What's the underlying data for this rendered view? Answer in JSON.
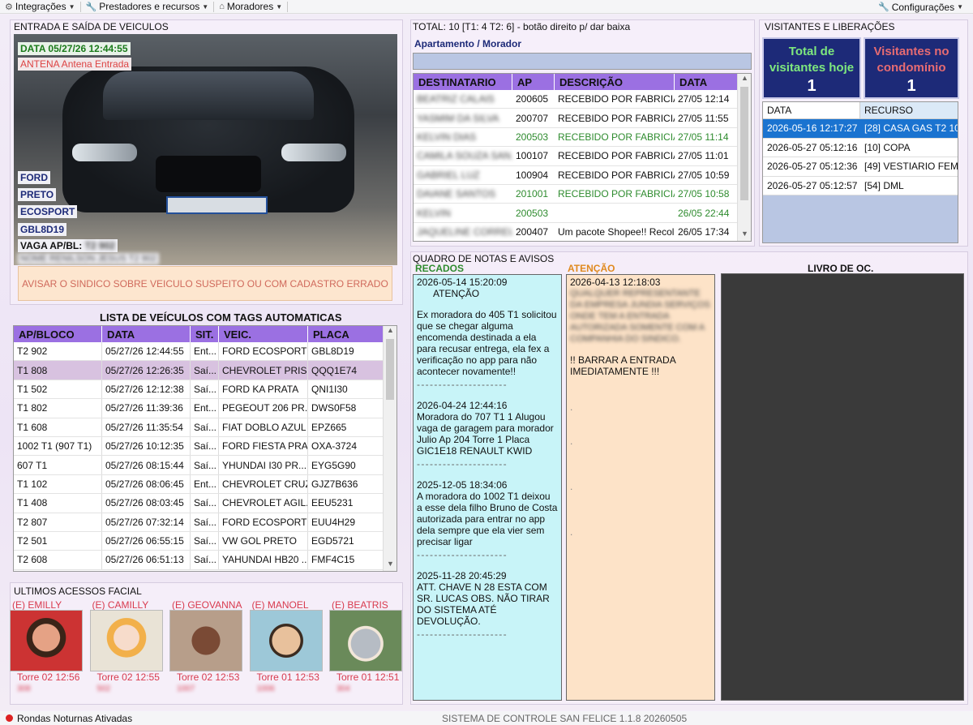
{
  "menu": {
    "integracoes": "Integrações",
    "prestadores": "Prestadores e recursos",
    "moradores": "Moradores",
    "configuracoes": "Configurações"
  },
  "vehicle_panel": {
    "title": "ENTRADA E SAÍDA DE VEICULOS",
    "date": "DATA 05/27/26 12:44:55",
    "antenna": "ANTENA Antena Entrada",
    "brand": "FORD",
    "color": "PRETO",
    "model": "ECOSPORT",
    "plate": "GBL8D19",
    "vaga_label": "VAGA AP/BL:",
    "vaga_value": "T2 902",
    "owner": "NOME RENILSON JESUS T2 902",
    "warning": "AVISAR O SINDICO SOBRE VEICULO SUSPEITO OU COM CADASTRO ERRADO"
  },
  "vehicle_list": {
    "title": "LISTA DE VEÍCULOS COM TAGS AUTOMATICAS",
    "columns": [
      "AP/BLOCO",
      "DATA",
      "SIT.",
      "VEIC.",
      "PLACA"
    ],
    "rows": [
      [
        "T2 902",
        "05/27/26 12:44:55",
        "Ent...",
        "FORD ECOSPORT ...",
        "GBL8D19"
      ],
      [
        "T1 808",
        "05/27/26 12:26:35",
        "Saí...",
        "CHEVROLET PRIS...",
        "QQQ1E74"
      ],
      [
        "T1 502",
        "05/27/26 12:12:38",
        "Saí...",
        "FORD KA PRATA",
        "QNI1I30"
      ],
      [
        "T1 802",
        "05/27/26 11:39:36",
        "Ent...",
        "PEGEOUT 206 PR...",
        "DWS0F58"
      ],
      [
        "T1 608",
        "05/27/26 11:35:54",
        "Saí...",
        "FIAT DOBLO AZUL",
        "EPZ665"
      ],
      [
        "1002 T1 (907 T1)",
        "05/27/26 10:12:35",
        "Saí...",
        "FORD FIESTA PRA...",
        "OXA-3724"
      ],
      [
        "607 T1",
        "05/27/26 08:15:44",
        "Saí...",
        "YHUNDAI I30 PR...",
        "EYG5G90"
      ],
      [
        "T1 102",
        "05/27/26 08:06:45",
        "Ent...",
        "CHEVROLET CRUZ...",
        "GJZ7B636"
      ],
      [
        "T1 408",
        "05/27/26 08:03:45",
        "Saí...",
        "CHEVROLET AGIL...",
        "EEU5231"
      ],
      [
        "T2 807",
        "05/27/26 07:32:14",
        "Saí...",
        "FORD ECOSPORT ...",
        "EUU4H29"
      ],
      [
        "T2 501",
        "05/27/26 06:55:15",
        "Saí...",
        "VW GOL PRETO",
        "EGD5721"
      ],
      [
        "T2 608",
        "05/27/26 06:51:13",
        "Saí...",
        "YAHUNDAI HB20 ...",
        "FMF4C15"
      ]
    ]
  },
  "facial": {
    "title": "ULTIMOS ACESSOS FACIAL",
    "items": [
      {
        "name": "(E) EMILLY",
        "time": "Torre 02 12:56",
        "id": "308"
      },
      {
        "name": "(E) CAMILLY",
        "time": "Torre 02 12:55",
        "id": "502"
      },
      {
        "name": "(E) GEOVANNA",
        "time": "Torre 02 12:53",
        "id": "1007"
      },
      {
        "name": "(E) MANOEL",
        "time": "Torre 01 12:53",
        "id": "1006"
      },
      {
        "name": "(E) BEATRIS",
        "time": "Torre 01 12:51",
        "id": "304"
      }
    ]
  },
  "packages": {
    "total": "TOTAL: 10 [T1: 4 T2: 6] - botão direito p/ dar baixa",
    "filter_label": "Apartamento / Morador",
    "columns": [
      "DESTINATARIO",
      "AP",
      "DESCRIÇÃO",
      "DATA"
    ],
    "rows": [
      {
        "dest": "BEATRIZ CALAIS",
        "ap": "200605",
        "desc": "RECEBIDO POR FABRICIA",
        "date": "27/05 12:14",
        "color": "#111111"
      },
      {
        "dest": "YASMIM DA SILVA",
        "ap": "200707",
        "desc": "RECEBIDO POR FABRICIA",
        "date": "27/05 11:55",
        "color": "#111111"
      },
      {
        "dest": "KELVIN DIAS",
        "ap": "200503",
        "desc": "RECEBIDO POR FABRICIA",
        "date": "27/05 11:14",
        "color": "#2e8b2e"
      },
      {
        "dest": "CAMILA SOUZA SAN...",
        "ap": "100107",
        "desc": "RECEBIDO POR FABRICIA",
        "date": "27/05 11:01",
        "color": "#111111"
      },
      {
        "dest": "GABRIEL LUZ",
        "ap": "100904",
        "desc": "RECEBIDO POR FABRICIA",
        "date": "27/05 10:59",
        "color": "#111111"
      },
      {
        "dest": "DAIANE SANTOS",
        "ap": "201001",
        "desc": "RECEBIDO POR FABRICIA",
        "date": "27/05 10:58",
        "color": "#2e8b2e"
      },
      {
        "dest": "KELVIN",
        "ap": "200503",
        "desc": "",
        "date": "26/05 22:44",
        "color": "#2e8b2e"
      },
      {
        "dest": "JAQUELINE CORREIA",
        "ap": "200407",
        "desc": "Um pacote Shopee!! Recol...",
        "date": "26/05 17:34",
        "color": "#111111"
      }
    ]
  },
  "notes": {
    "title": "QUADRO DE NOTAS E AVISOS",
    "recados_label": "RECADOS",
    "atencao_label": "ATENÇÃO",
    "livro_label": "LIVRO DE OC.",
    "recados": [
      {
        "ts": "2026-05-14 15:20:09",
        "head": "ATENÇÃO",
        "body": "Ex moradora do 405 T1 solicitou que se chegar alguma encomenda destinada a ela para recusar entrega, ela fex a verificação no app para não acontecer novamente!!"
      },
      {
        "ts": "2026-04-24 12:44:16",
        "head": "",
        "body": "Moradora do 707 T1 1 Alugou vaga de garagem para morador Julio Ap 204 Torre 1 Placa GIC1E18 RENAULT KWID"
      },
      {
        "ts": "2025-12-05 18:34:06",
        "head": "",
        "body": "A moradora do 1002 T1 deixou a esse dela filho Bruno de Costa autorizada para entrar no app dela sempre que ela vier sem precisar ligar"
      },
      {
        "ts": "2025-11-28 20:45:29",
        "head": "",
        "body": "ATT. CHAVE N 28 ESTA COM SR. LUCAS OBS. NÃO TIRAR DO SISTEMA ATÉ DEVOLUÇÃO."
      }
    ],
    "atencao": {
      "ts": "2026-04-13 12:18:03",
      "body": "QUALQUER REPRESENTANTE DA EMPRESA JUNDIA SERVIÇOS ONDE TEM A ENTRADA AUTORIZADA SOMENTE COM A COMPANHIA DO SINDICO.",
      "alert": "!! BARRAR A ENTRADA IMEDIATAMENTE !!!"
    }
  },
  "visitors": {
    "title": "VISITANTES E LIBERAÇÕES",
    "today_label": "Total de visitantes hoje",
    "today_value": "1",
    "inside_label": "Visitantes no condomínio",
    "inside_value": "1",
    "columns": [
      "DATA",
      "RECURSO"
    ],
    "rows": [
      [
        "2026-05-16 12:17:27",
        "[28] CASA GAS T2 105"
      ],
      [
        "2026-05-27 05:12:16",
        "[10] COPA"
      ],
      [
        "2026-05-27 05:12:36",
        "[49] VESTIARIO FEM..."
      ],
      [
        "2026-05-27 05:12:57",
        "[54] DML"
      ]
    ]
  },
  "status": {
    "rondas": "Rondas Noturnas Ativadas",
    "system": "SISTEMA DE CONTROLE SAN FELICE 1.1.8 20260505"
  }
}
